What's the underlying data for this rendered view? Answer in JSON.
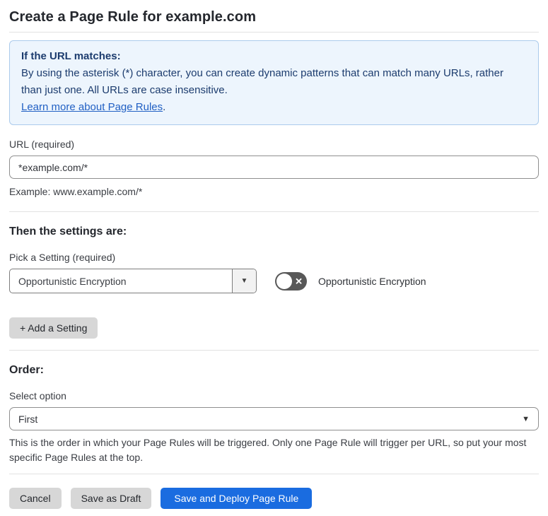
{
  "page": {
    "title": "Create a Page Rule for example.com"
  },
  "info_box": {
    "heading": "If the URL matches:",
    "body": "By using the asterisk (*) character, you can create dynamic patterns that can match many URLs, rather than just one. All URLs are case insensitive.",
    "link_label": "Learn more about Page Rules",
    "link_suffix": "."
  },
  "url_section": {
    "label": "URL (required)",
    "value": "*example.com/*",
    "helper": "Example: www.example.com/*"
  },
  "settings_section": {
    "heading": "Then the settings are:",
    "picker_label": "Pick a Setting (required)",
    "selected_setting": "Opportunistic Encryption",
    "dropdown_arrow": "▼",
    "toggle_state": "off",
    "toggle_x": "✕",
    "toggle_label": "Opportunistic Encryption",
    "add_setting_label": "+ Add a Setting"
  },
  "order_section": {
    "heading": "Order:",
    "select_label": "Select option",
    "selected_option": "First",
    "select_chevron": "▼",
    "helper": "This is the order in which your Page Rules will be triggered. Only one Page Rule will trigger per URL, so put your most specific Page Rules at the top."
  },
  "actions": {
    "cancel_label": "Cancel",
    "save_draft_label": "Save as Draft",
    "save_deploy_label": "Save and Deploy Page Rule"
  },
  "colors": {
    "accent_blue": "#1a6ce0",
    "info_background": "#edf5fd",
    "info_border": "#abcbec",
    "info_text": "#1c3c6e",
    "link_blue": "#2160c4",
    "toggle_off_background": "#585858",
    "button_gray": "#d7d7d7"
  }
}
